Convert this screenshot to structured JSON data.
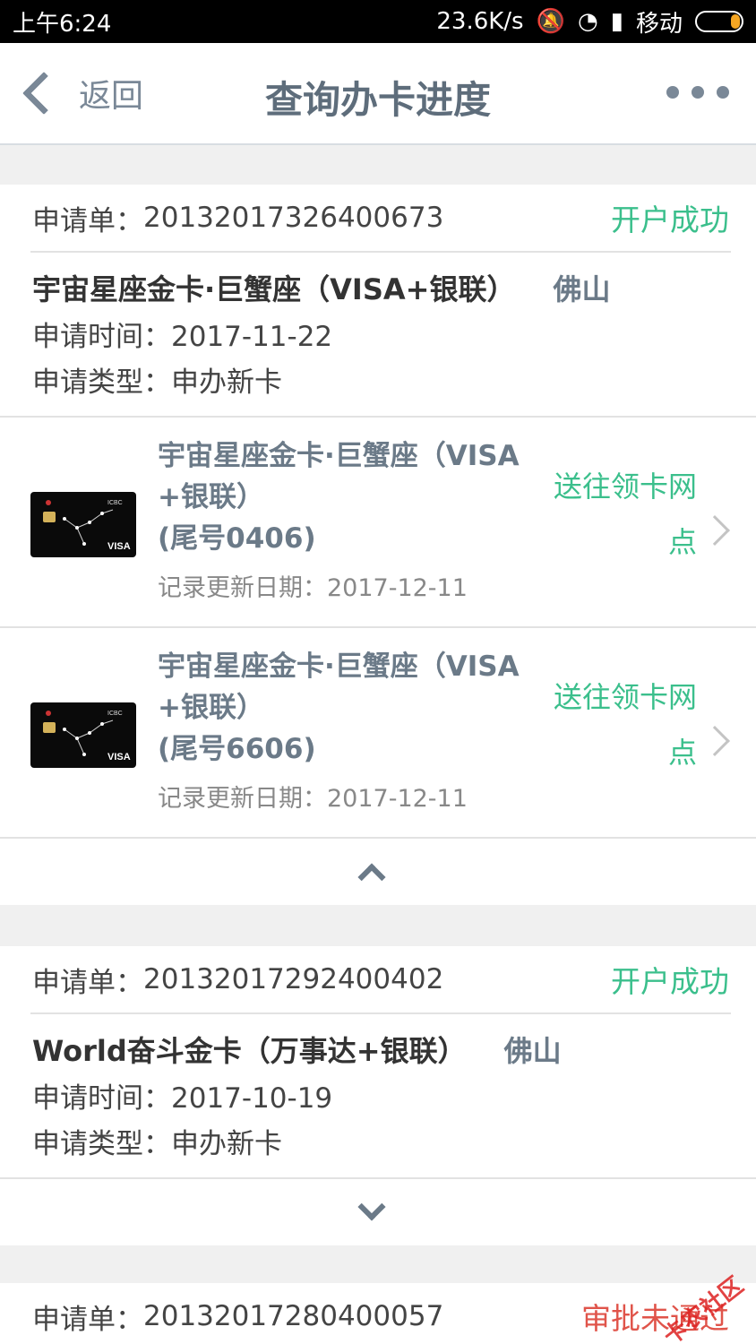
{
  "statusbar": {
    "time": "上午6:24",
    "speed": "23.6K/s",
    "carrier": "移动"
  },
  "header": {
    "back_label": "返回",
    "title": "查询办卡进度"
  },
  "applications": [
    {
      "order_label": "申请单：",
      "order_no": "20132017326400673",
      "status": "开户成功",
      "status_color": "#3bbf8c",
      "card_name": "宇宙星座金卡·巨蟹座（VISA+银联）",
      "city": "佛山",
      "apply_time": "申请时间：2017-11-22",
      "apply_type": "申请类型：申办新卡",
      "cards": [
        {
          "title_line1": "宇宙星座金卡·巨蟹座（VISA",
          "title_line2": "+银联）",
          "tail": "(尾号0406)",
          "update": "记录更新日期：2017-12-11",
          "status_line1": "送往领卡网",
          "status_line2": "点"
        },
        {
          "title_line1": "宇宙星座金卡·巨蟹座（VISA",
          "title_line2": "+银联）",
          "tail": "(尾号6606)",
          "update": "记录更新日期：2017-12-11",
          "status_line1": "送往领卡网",
          "status_line2": "点"
        }
      ]
    },
    {
      "order_label": "申请单：",
      "order_no": "20132017292400402",
      "status": "开户成功",
      "status_color": "#3bbf8c",
      "card_name": "World奋斗金卡（万事达+银联）",
      "city": "佛山",
      "apply_time": "申请时间：2017-10-19",
      "apply_type": "申请类型：申办新卡"
    },
    {
      "order_label": "申请单：",
      "order_no": "20132017280400057",
      "status": "审批未通过",
      "status_color": "#e0544a"
    }
  ],
  "card_image": {
    "brand_text": "ICBC",
    "network_text": "VISA"
  },
  "watermark": "卡农社区"
}
